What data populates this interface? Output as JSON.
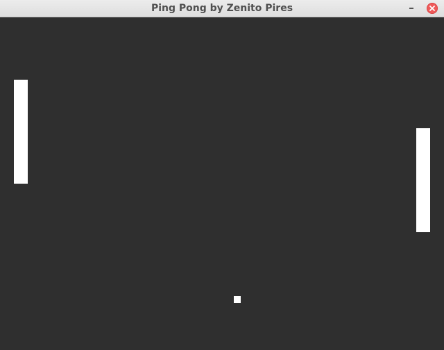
{
  "window": {
    "title": "Ping Pong by Zenito Pires",
    "controls": {
      "minimize_icon": "minimize-icon",
      "close_icon": "close-icon",
      "close_color": "#ef5a5a"
    }
  },
  "game": {
    "background_color": "#2f2f2f",
    "paddle_color": "#ffffff",
    "ball_color": "#ffffff"
  }
}
